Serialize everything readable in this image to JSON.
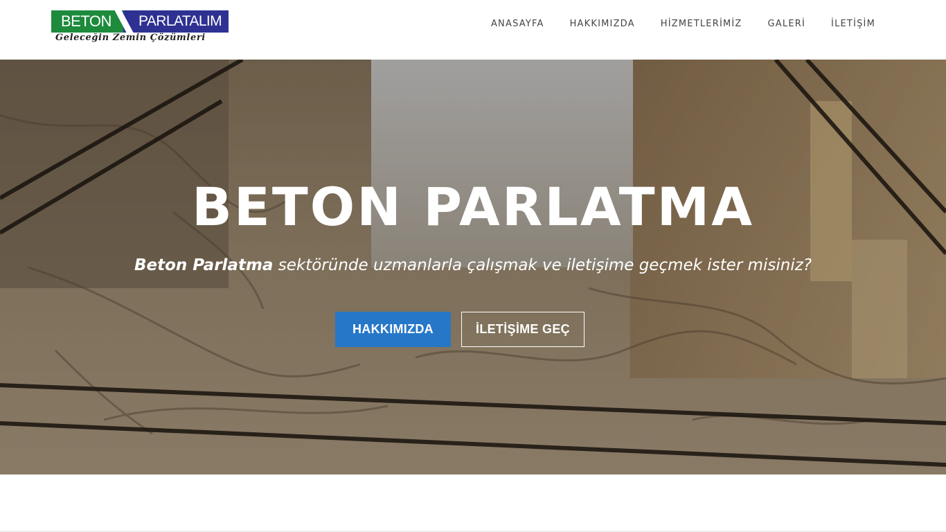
{
  "logo": {
    "left_text": "BETON",
    "right_text": "PARLATALIM",
    "tagline": "Geleceğin Zemin Çözümleri"
  },
  "nav": {
    "items": [
      {
        "label": "ANASAYFA"
      },
      {
        "label": "HAKKIMIZDA"
      },
      {
        "label": "HİZMETLERİMİZ"
      },
      {
        "label": "GALERİ"
      },
      {
        "label": "İLETİŞİM"
      }
    ]
  },
  "hero": {
    "title": "BETON PARLATMA",
    "subtitle_bold": "Beton Parlatma",
    "subtitle_rest": " sektöründe uzmanlarla çalışmak ve iletişime geçmek ister misiniz?",
    "primary_button": "HAKKIMIZDA",
    "secondary_button": "İLETİŞİME GEÇ"
  },
  "colors": {
    "logo_green": "#1d8a3c",
    "logo_blue": "#2e3191",
    "button_blue": "#2777c8"
  }
}
